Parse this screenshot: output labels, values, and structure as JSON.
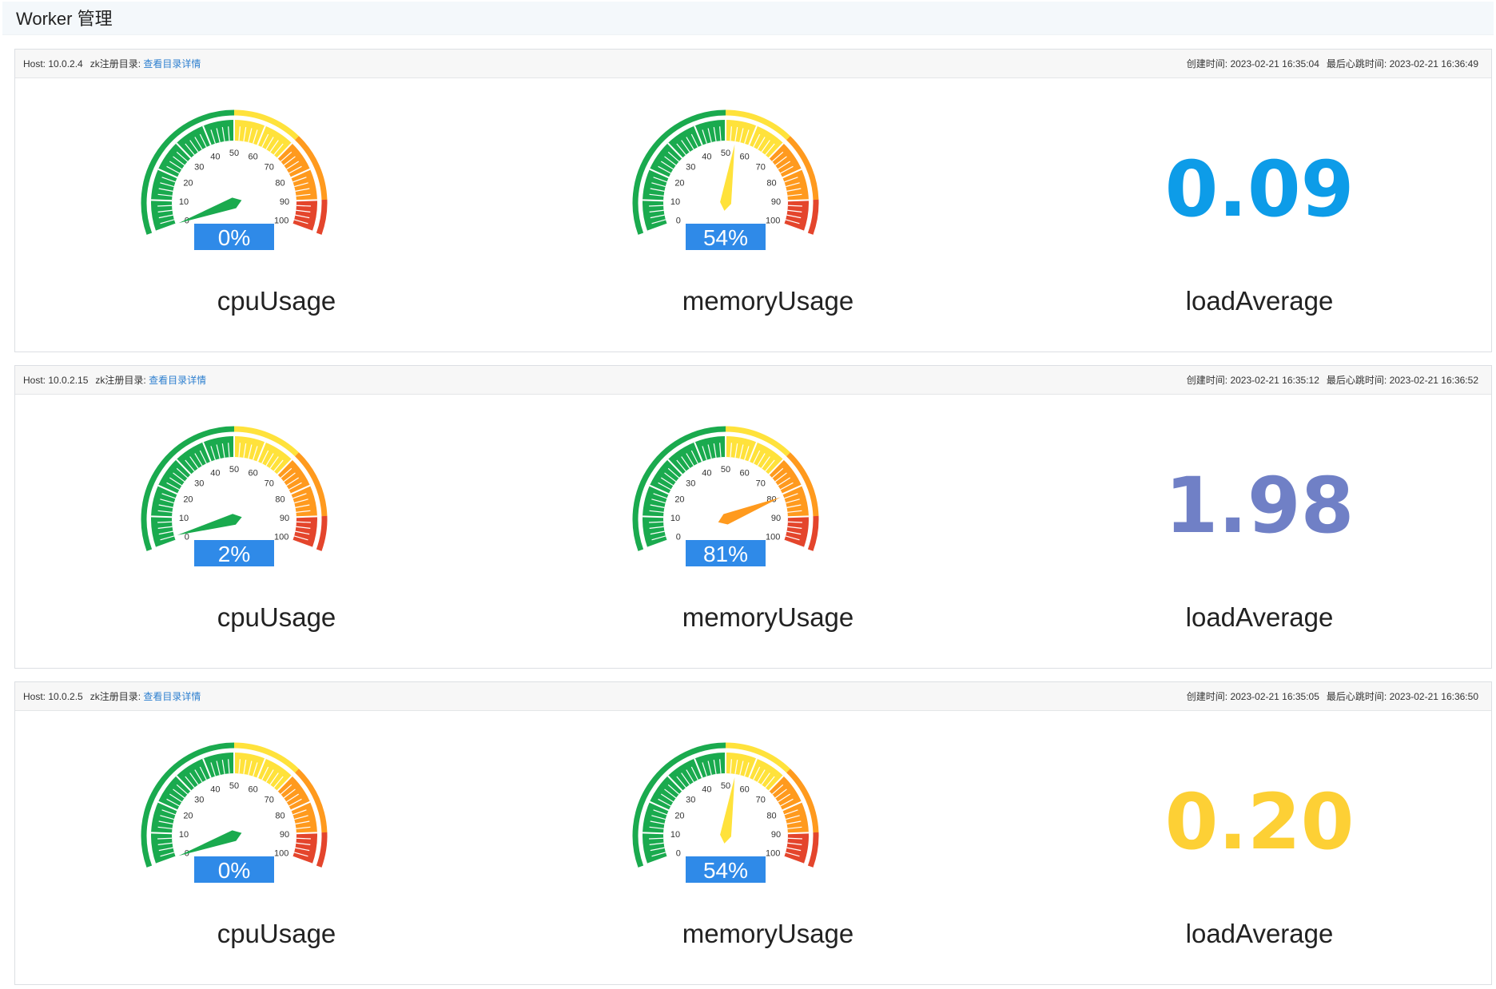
{
  "page": {
    "title": "Worker 管理"
  },
  "labels": {
    "host_prefix": "Host: ",
    "zk_prefix": "zk注册目录: ",
    "zk_link": "查看目录详情",
    "created_prefix": "创建时间: ",
    "heartbeat_prefix": "最后心跳时间: "
  },
  "gauge": {
    "min": 0,
    "max": 100,
    "tick_labels": [
      "0",
      "10",
      "20",
      "30",
      "40",
      "50",
      "60",
      "70",
      "80",
      "90",
      "100"
    ],
    "bands": [
      {
        "to": 50,
        "color": "#1aaa4e"
      },
      {
        "to": 70,
        "color": "#ffe23b"
      },
      {
        "to": 90,
        "color": "#ff9a1e"
      },
      {
        "to": 100,
        "color": "#e4452c"
      }
    ]
  },
  "colors": {
    "value_box": "#2f8ae8",
    "link": "#2d7fcf"
  },
  "workers": [
    {
      "host": "10.0.2.4",
      "created": "2023-02-21 16:35:04",
      "heartbeat": "2023-02-21 16:36:49",
      "cpu": {
        "label": "cpuUsage",
        "value": 0,
        "display": "0%"
      },
      "memory": {
        "label": "memoryUsage",
        "value": 54,
        "display": "54%"
      },
      "load": {
        "label": "loadAverage",
        "value": "0.09",
        "color": "#0d9ce8"
      }
    },
    {
      "host": "10.0.2.15",
      "created": "2023-02-21 16:35:12",
      "heartbeat": "2023-02-21 16:36:52",
      "cpu": {
        "label": "cpuUsage",
        "value": 2,
        "display": "2%"
      },
      "memory": {
        "label": "memoryUsage",
        "value": 81,
        "display": "81%"
      },
      "load": {
        "label": "loadAverage",
        "value": "1.98",
        "color": "#7080c6"
      }
    },
    {
      "host": "10.0.2.5",
      "created": "2023-02-21 16:35:05",
      "heartbeat": "2023-02-21 16:36:50",
      "cpu": {
        "label": "cpuUsage",
        "value": 0,
        "display": "0%"
      },
      "memory": {
        "label": "memoryUsage",
        "value": 54,
        "display": "54%"
      },
      "load": {
        "label": "loadAverage",
        "value": "0.20",
        "color": "#fdd035"
      }
    }
  ]
}
